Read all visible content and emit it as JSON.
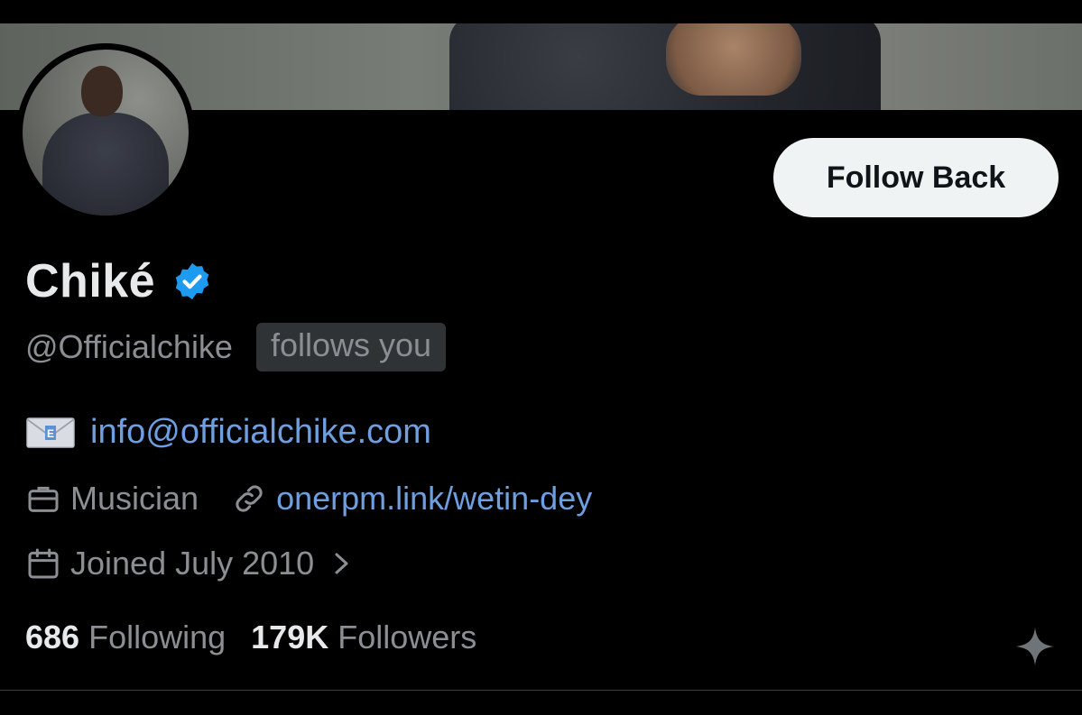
{
  "profile": {
    "display_name": "Chiké",
    "handle": "@Officialchike",
    "follows_you": "follows you",
    "email": "info@officialchike.com",
    "profession": "Musician",
    "link": "onerpm.link/wetin-dey",
    "joined": "Joined July 2010",
    "following_count": "686",
    "following_label": "Following",
    "followers_count": "179K",
    "followers_label": "Followers"
  },
  "actions": {
    "follow_label": "Follow Back"
  },
  "icons": {
    "verified": "verified-badge-icon",
    "email": "envelope-icon",
    "profession": "briefcase-icon",
    "link": "link-icon",
    "joined": "calendar-icon",
    "chevron": "chevron-right-icon",
    "sparkle": "sparkle-icon"
  },
  "colors": {
    "verified_blue": "#1d9bf0",
    "link_blue": "#6e9fe0",
    "muted_text": "#8b8f93",
    "button_bg": "#eff3f4"
  }
}
